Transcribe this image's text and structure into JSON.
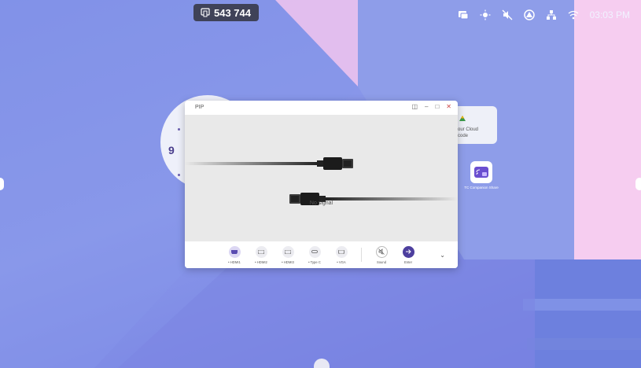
{
  "meeting_code": "543 744",
  "status_bar": {
    "time": "03:03 PM",
    "icons": [
      "screen-share-icon",
      "brightness-icon",
      "mute-icon",
      "drive-icon",
      "network-icon",
      "wifi-icon"
    ]
  },
  "clock_widget": {
    "hour": "9"
  },
  "cloud_widget": {
    "lines": [
      "our Cloud",
      "code"
    ]
  },
  "cast_app": {
    "label": "TC Companion Share"
  },
  "pip_window": {
    "title": "PIP",
    "no_signal": "No signal",
    "sources": [
      {
        "label": "• HDMI1",
        "active": true
      },
      {
        "label": "• HDMI2",
        "active": false
      },
      {
        "label": "• HDMI3",
        "active": false
      },
      {
        "label": "• Type C",
        "active": false
      },
      {
        "label": "• VGA",
        "active": false
      }
    ],
    "actions": [
      {
        "label": "Sound"
      },
      {
        "label": "Enter"
      }
    ]
  },
  "colors": {
    "accent": "#5a4bb0",
    "badge_bg": "#3f4258"
  }
}
